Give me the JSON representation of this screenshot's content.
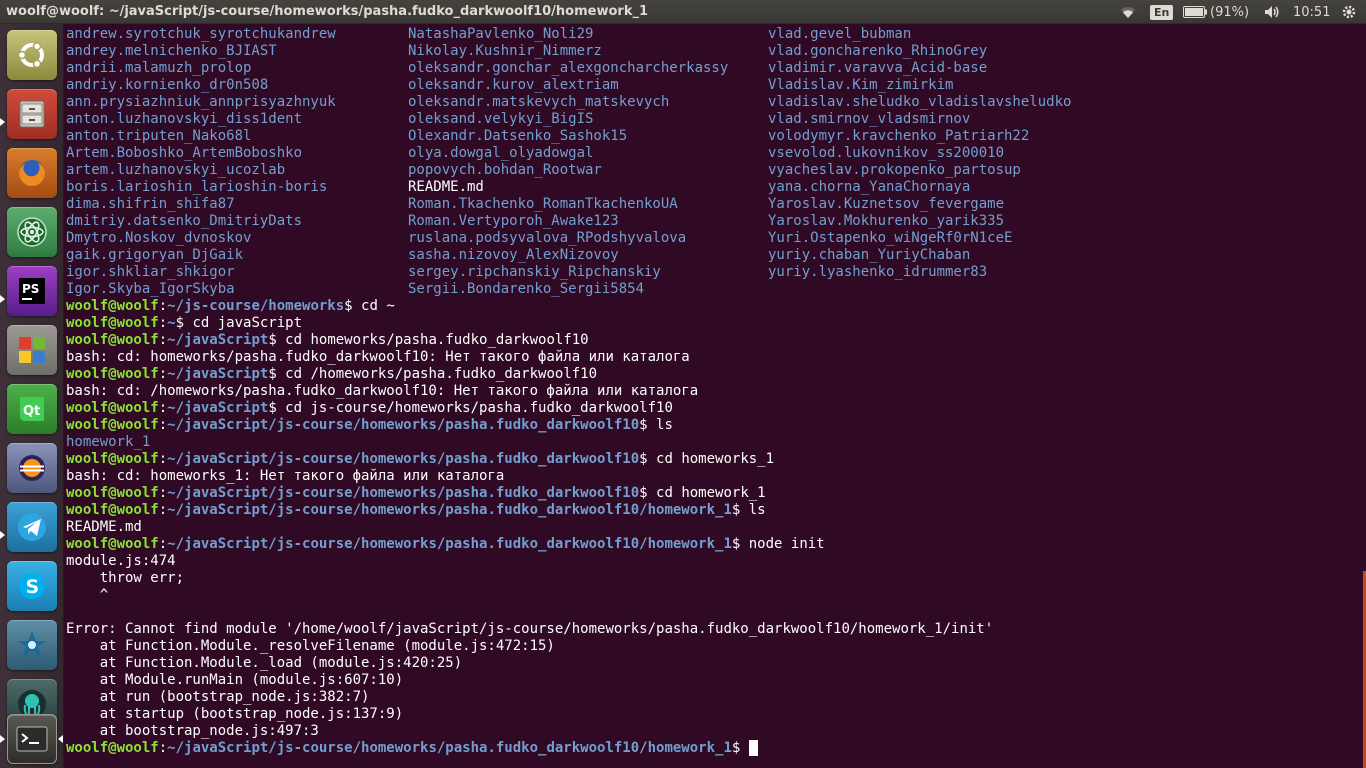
{
  "topbar": {
    "title": "woolf@woolf: ~/javaScript/js-course/homeworks/pasha.fudko_darkwoolf10/homework_1",
    "lang": "En",
    "battery": "(91%)",
    "clock": "10:51"
  },
  "launcher": {
    "items": [
      "ubuntu-dash",
      "files",
      "firefox",
      "atom",
      "phpstorm",
      "libreoffice",
      "qt-creator",
      "eclipse",
      "telegram",
      "skype",
      "mysql-workbench",
      "gitkraken",
      "terminal"
    ]
  },
  "terminal": {
    "listing": [
      [
        "andrew.syrotchuk_syrotchukandrew",
        "NatashaPavlenko_Noli29",
        "vlad.gevel_bubman"
      ],
      [
        "andrey.melnichenko_BJIAST",
        "Nikolay.Kushnir_Nimmerz",
        "vlad.goncharenko_RhinoGrey"
      ],
      [
        "andrii.malamuzh_prolop",
        "oleksandr.gonchar_alexgoncharcherkassy",
        "vladimir.varavva_Acid-base"
      ],
      [
        "andriy.kornienko_dr0n508",
        "oleksandr.kurov_alextriam",
        "Vladislav.Kim_zimirkim"
      ],
      [
        "ann.prysiazhniuk_annprisyazhnyuk",
        "oleksandr.matskevych_matskevych",
        "vladislav.sheludko_vladislavsheludko"
      ],
      [
        "anton.luzhanovskyi_diss1dent",
        "oleksand.velykyi_BigIS",
        "vlad.smirnov_vladsmirnov"
      ],
      [
        "anton.triputen_Nako68l",
        "Olexandr.Datsenko_Sashok15",
        "volodymyr.kravchenko_Patriarh22"
      ],
      [
        "Artem.Boboshko_ArtemBoboshko",
        "olya.dowgal_olyadowgal",
        "vsevolod.lukovnikov_ss200010"
      ],
      [
        "artem.luzhanovskyi_ucozlab",
        "popovych.bohdan_Rootwar",
        "vyacheslav.prokopenko_partosup"
      ],
      [
        "boris.larioshin_larioshin-boris",
        "README.md",
        "yana.chorna_YanaChornaya"
      ],
      [
        "dima.shifrin_shifa87",
        "Roman.Tkachenko_RomanTkachenkoUA",
        "Yaroslav.Kuznetsov_fevergame"
      ],
      [
        "dmitriy.datsenko_DmitriyDats",
        "Roman.Vertyporoh_Awake123",
        "Yaroslav.Mokhurenko_yarik335"
      ],
      [
        "Dmytro.Noskov_dvnoskov",
        "ruslana.podsyvalova_RPodshyvalova",
        "Yuri.Ostapenko_wiNgeRf0rN1ceE"
      ],
      [
        "gaik.grigoryan_DjGaik",
        "sasha.nizovoy_AlexNizovoy",
        "yuriy.chaban_YuriyChaban"
      ],
      [
        "igor.shkliar_shkigor",
        "sergey.ripchanskiy_Ripchanskiy",
        "yuriy.lyashenko_idrummer83"
      ],
      [
        "Igor.Skyba_IgorSkyba",
        "Sergii.Bondarenko_Sergii5854",
        ""
      ]
    ],
    "user": "woolf@woolf",
    "sep": ":",
    "session": [
      {
        "path": "~/js-course/homeworks",
        "cmd": "$ cd ~"
      },
      {
        "path": "~",
        "cmd": "$ cd javaScript"
      },
      {
        "path": "~/javaScript",
        "cmd": "$ cd homeworks/pasha.fudko_darkwoolf10"
      },
      {
        "out": "bash: cd: homeworks/pasha.fudko_darkwoolf10: Нет такого файла или каталога"
      },
      {
        "path": "~/javaScript",
        "cmd": "$ cd /homeworks/pasha.fudko_darkwoolf10"
      },
      {
        "out": "bash: cd: /homeworks/pasha.fudko_darkwoolf10: Нет такого файла или каталога"
      },
      {
        "path": "~/javaScript",
        "cmd": "$ cd js-course/homeworks/pasha.fudko_darkwoolf10"
      },
      {
        "path": "~/javaScript/js-course/homeworks/pasha.fudko_darkwoolf10",
        "cmd": "$ ls"
      },
      {
        "dir": "homework_1"
      },
      {
        "path": "~/javaScript/js-course/homeworks/pasha.fudko_darkwoolf10",
        "cmd": "$ cd homeworks_1"
      },
      {
        "out": "bash: cd: homeworks_1: Нет такого файла или каталога"
      },
      {
        "path": "~/javaScript/js-course/homeworks/pasha.fudko_darkwoolf10",
        "cmd": "$ cd homework_1"
      },
      {
        "path": "~/javaScript/js-course/homeworks/pasha.fudko_darkwoolf10/homework_1",
        "cmd": "$ ls"
      },
      {
        "out": "README.md"
      },
      {
        "path": "~/javaScript/js-course/homeworks/pasha.fudko_darkwoolf10/homework_1",
        "cmd": "$ node init"
      },
      {
        "out": "module.js:474"
      },
      {
        "out": "    throw err;"
      },
      {
        "out": "    ^"
      },
      {
        "out": ""
      },
      {
        "out": "Error: Cannot find module '/home/woolf/javaScript/js-course/homeworks/pasha.fudko_darkwoolf10/homework_1/init'"
      },
      {
        "out": "    at Function.Module._resolveFilename (module.js:472:15)"
      },
      {
        "out": "    at Function.Module._load (module.js:420:25)"
      },
      {
        "out": "    at Module.runMain (module.js:607:10)"
      },
      {
        "out": "    at run (bootstrap_node.js:382:7)"
      },
      {
        "out": "    at startup (bootstrap_node.js:137:9)"
      },
      {
        "out": "    at bootstrap_node.js:497:3"
      },
      {
        "path": "~/javaScript/js-course/homeworks/pasha.fudko_darkwoolf10/homework_1",
        "cmd": "$ ",
        "cursor": true
      }
    ]
  }
}
